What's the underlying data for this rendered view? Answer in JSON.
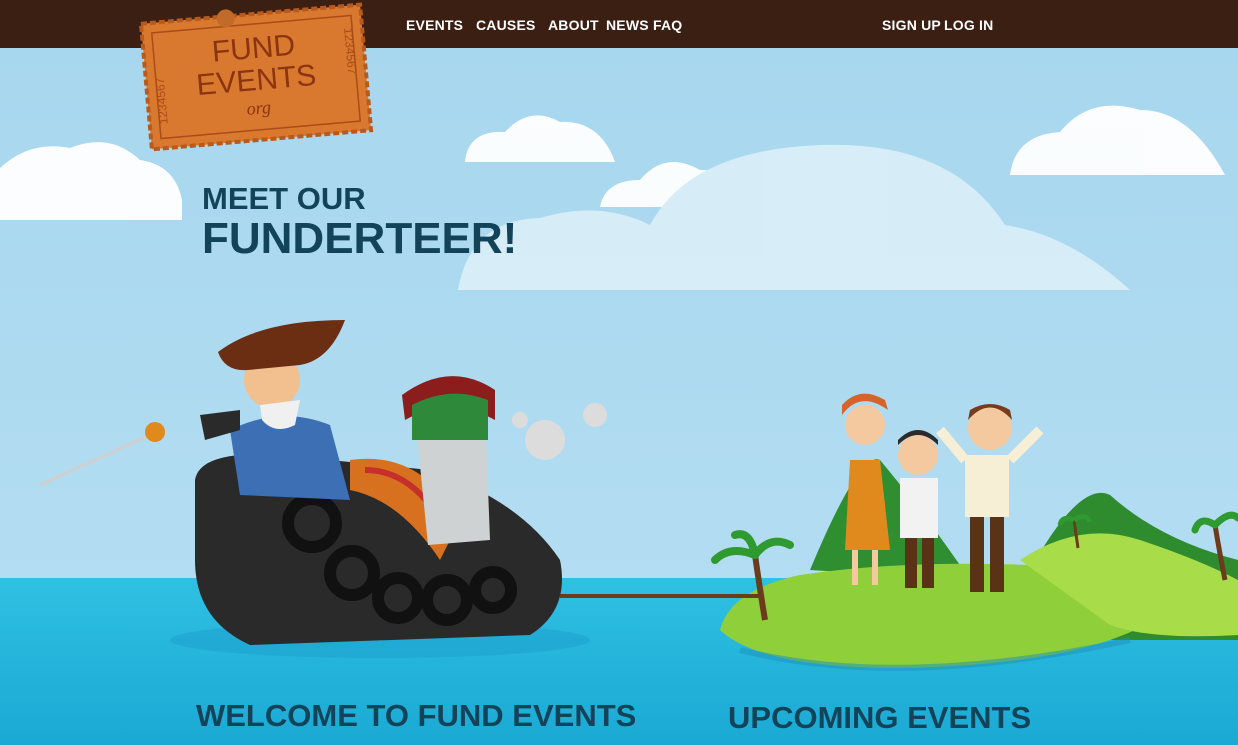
{
  "nav": {
    "events": "EVENTS",
    "causes": "CAUSES",
    "about": "ABOUT",
    "news": "NEWS",
    "faq": "FAQ",
    "sign_up": "SIGN UP",
    "log_in": "LOG IN"
  },
  "logo": {
    "line1": "FUND",
    "line2": "EVENTS",
    "line3": "org",
    "ticket_numbers": "1234567"
  },
  "hero": {
    "line1": "MEET OUR",
    "line2": "FUNDERTEER!"
  },
  "sections": {
    "welcome": "WELCOME TO FUND EVENTS",
    "upcoming": "UPCOMING EVENTS"
  },
  "colors": {
    "topbar": "#3b1f12",
    "sky": "#a6d6ee",
    "sea": "#2fc0e3",
    "heading": "#134359",
    "ticket": "#d9782f"
  }
}
